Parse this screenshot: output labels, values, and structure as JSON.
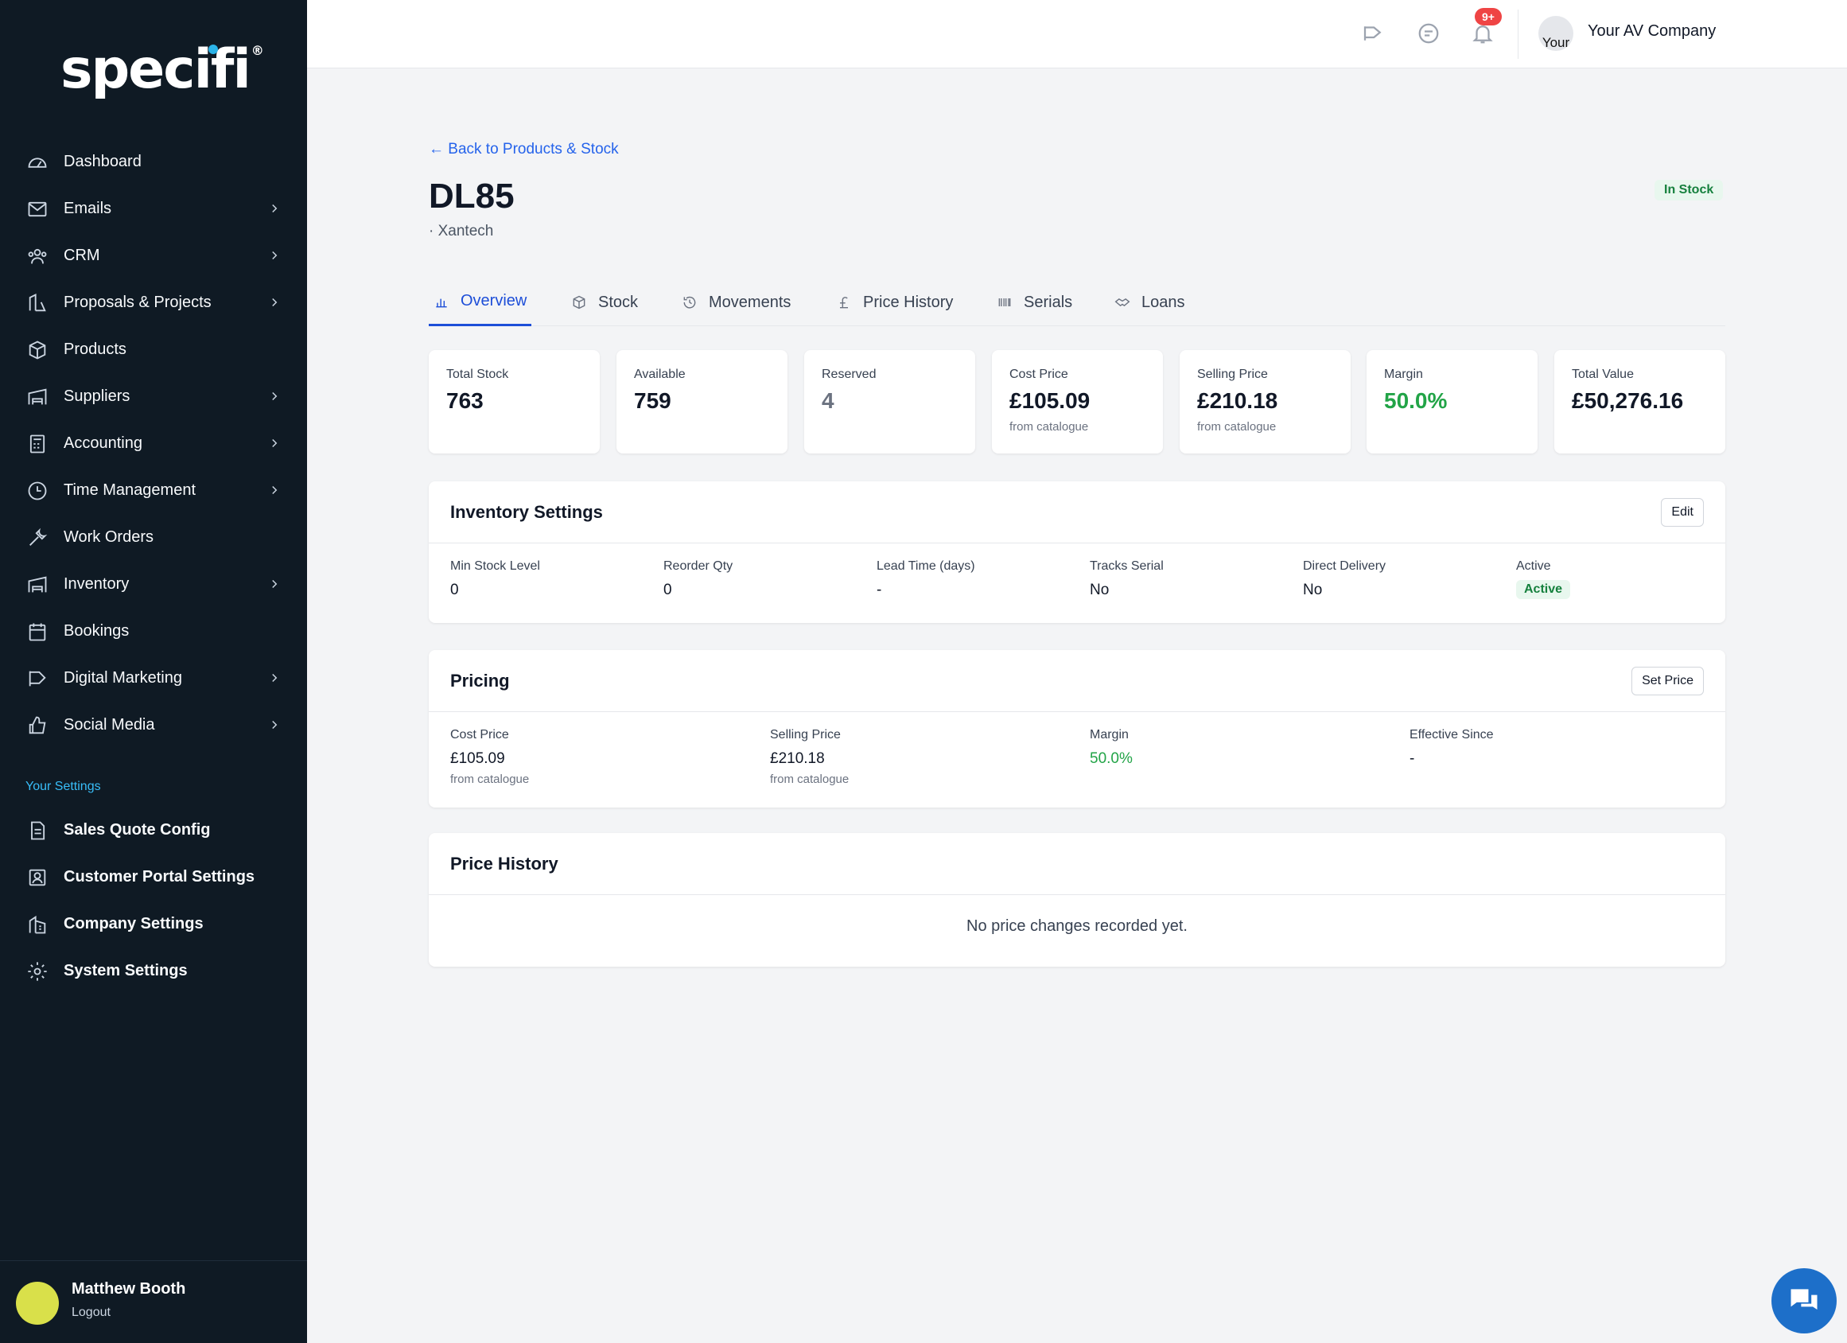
{
  "sidebar": {
    "logo": "specifi",
    "logo_reg": "®",
    "nav": [
      {
        "label": "Dashboard",
        "icon": "gauge-icon",
        "chevron": false
      },
      {
        "label": "Emails",
        "icon": "mail-icon",
        "chevron": true
      },
      {
        "label": "CRM",
        "icon": "users-icon",
        "chevron": true
      },
      {
        "label": "Proposals & Projects",
        "icon": "drafting-icon",
        "chevron": true
      },
      {
        "label": "Products",
        "icon": "box-icon",
        "chevron": false
      },
      {
        "label": "Suppliers",
        "icon": "warehouse-icon",
        "chevron": true
      },
      {
        "label": "Accounting",
        "icon": "calculator-icon",
        "chevron": true
      },
      {
        "label": "Time Management",
        "icon": "clock-icon",
        "chevron": true
      },
      {
        "label": "Work Orders",
        "icon": "wrench-icon",
        "chevron": false
      },
      {
        "label": "Inventory",
        "icon": "warehouse-icon",
        "chevron": true
      },
      {
        "label": "Bookings",
        "icon": "calendar-icon",
        "chevron": false
      },
      {
        "label": "Digital Marketing",
        "icon": "megaphone-icon",
        "chevron": true
      },
      {
        "label": "Social Media",
        "icon": "thumbs-up-icon",
        "chevron": true
      }
    ],
    "settings_title": "Your Settings",
    "settings": [
      {
        "label": "Sales Quote Config",
        "icon": "document-icon"
      },
      {
        "label": "Customer Portal Settings",
        "icon": "portal-icon"
      },
      {
        "label": "Company Settings",
        "icon": "building-icon"
      },
      {
        "label": "System Settings",
        "icon": "gear-icon"
      }
    ],
    "user_name": "Matthew Booth",
    "logout": "Logout"
  },
  "topbar": {
    "notification_badge": "9+",
    "avatar_alt": "Your",
    "company": "Your AV Company"
  },
  "product": {
    "back": "← Back to Products & Stock",
    "title": "DL85",
    "brand": "· Xantech",
    "status": "In Stock"
  },
  "tabs": [
    {
      "label": "Overview",
      "icon": "bar-chart-icon",
      "active": true
    },
    {
      "label": "Stock",
      "icon": "box-icon",
      "active": false
    },
    {
      "label": "Movements",
      "icon": "history-icon",
      "active": false
    },
    {
      "label": "Price History",
      "icon": "pound-icon",
      "active": false
    },
    {
      "label": "Serials",
      "icon": "barcode-icon",
      "active": false
    },
    {
      "label": "Loans",
      "icon": "handshake-icon",
      "active": false
    }
  ],
  "stats": [
    {
      "label": "Total Stock",
      "value": "763",
      "sub": ""
    },
    {
      "label": "Available",
      "value": "759",
      "sub": ""
    },
    {
      "label": "Reserved",
      "value": "4",
      "sub": ""
    },
    {
      "label": "Cost Price",
      "value": "£105.09",
      "sub": "from catalogue"
    },
    {
      "label": "Selling Price",
      "value": "£210.18",
      "sub": "from catalogue"
    },
    {
      "label": "Margin",
      "value": "50.0%",
      "sub": ""
    },
    {
      "label": "Total Value",
      "value": "£50,276.16",
      "sub": ""
    }
  ],
  "inventory": {
    "title": "Inventory Settings",
    "edit": "Edit",
    "fields": [
      {
        "label": "Min Stock Level",
        "value": "0"
      },
      {
        "label": "Reorder Qty",
        "value": "0"
      },
      {
        "label": "Lead Time (days)",
        "value": "-"
      },
      {
        "label": "Tracks Serial",
        "value": "No"
      },
      {
        "label": "Direct Delivery",
        "value": "No"
      },
      {
        "label": "Active",
        "value": "Active"
      }
    ]
  },
  "pricing": {
    "title": "Pricing",
    "button": "Set Price",
    "fields": [
      {
        "label": "Cost Price",
        "value": "£105.09",
        "sub": "from catalogue"
      },
      {
        "label": "Selling Price",
        "value": "£210.18",
        "sub": "from catalogue"
      },
      {
        "label": "Margin",
        "value": "50.0%",
        "sub": ""
      },
      {
        "label": "Effective Since",
        "value": "-",
        "sub": ""
      }
    ]
  },
  "price_history": {
    "title": "Price History",
    "empty": "No price changes recorded yet."
  },
  "colors": {
    "sidebar_bg": "#0f1a24",
    "accent": "#1d4ed8",
    "success": "#22a447",
    "badge": "#ef4444"
  }
}
